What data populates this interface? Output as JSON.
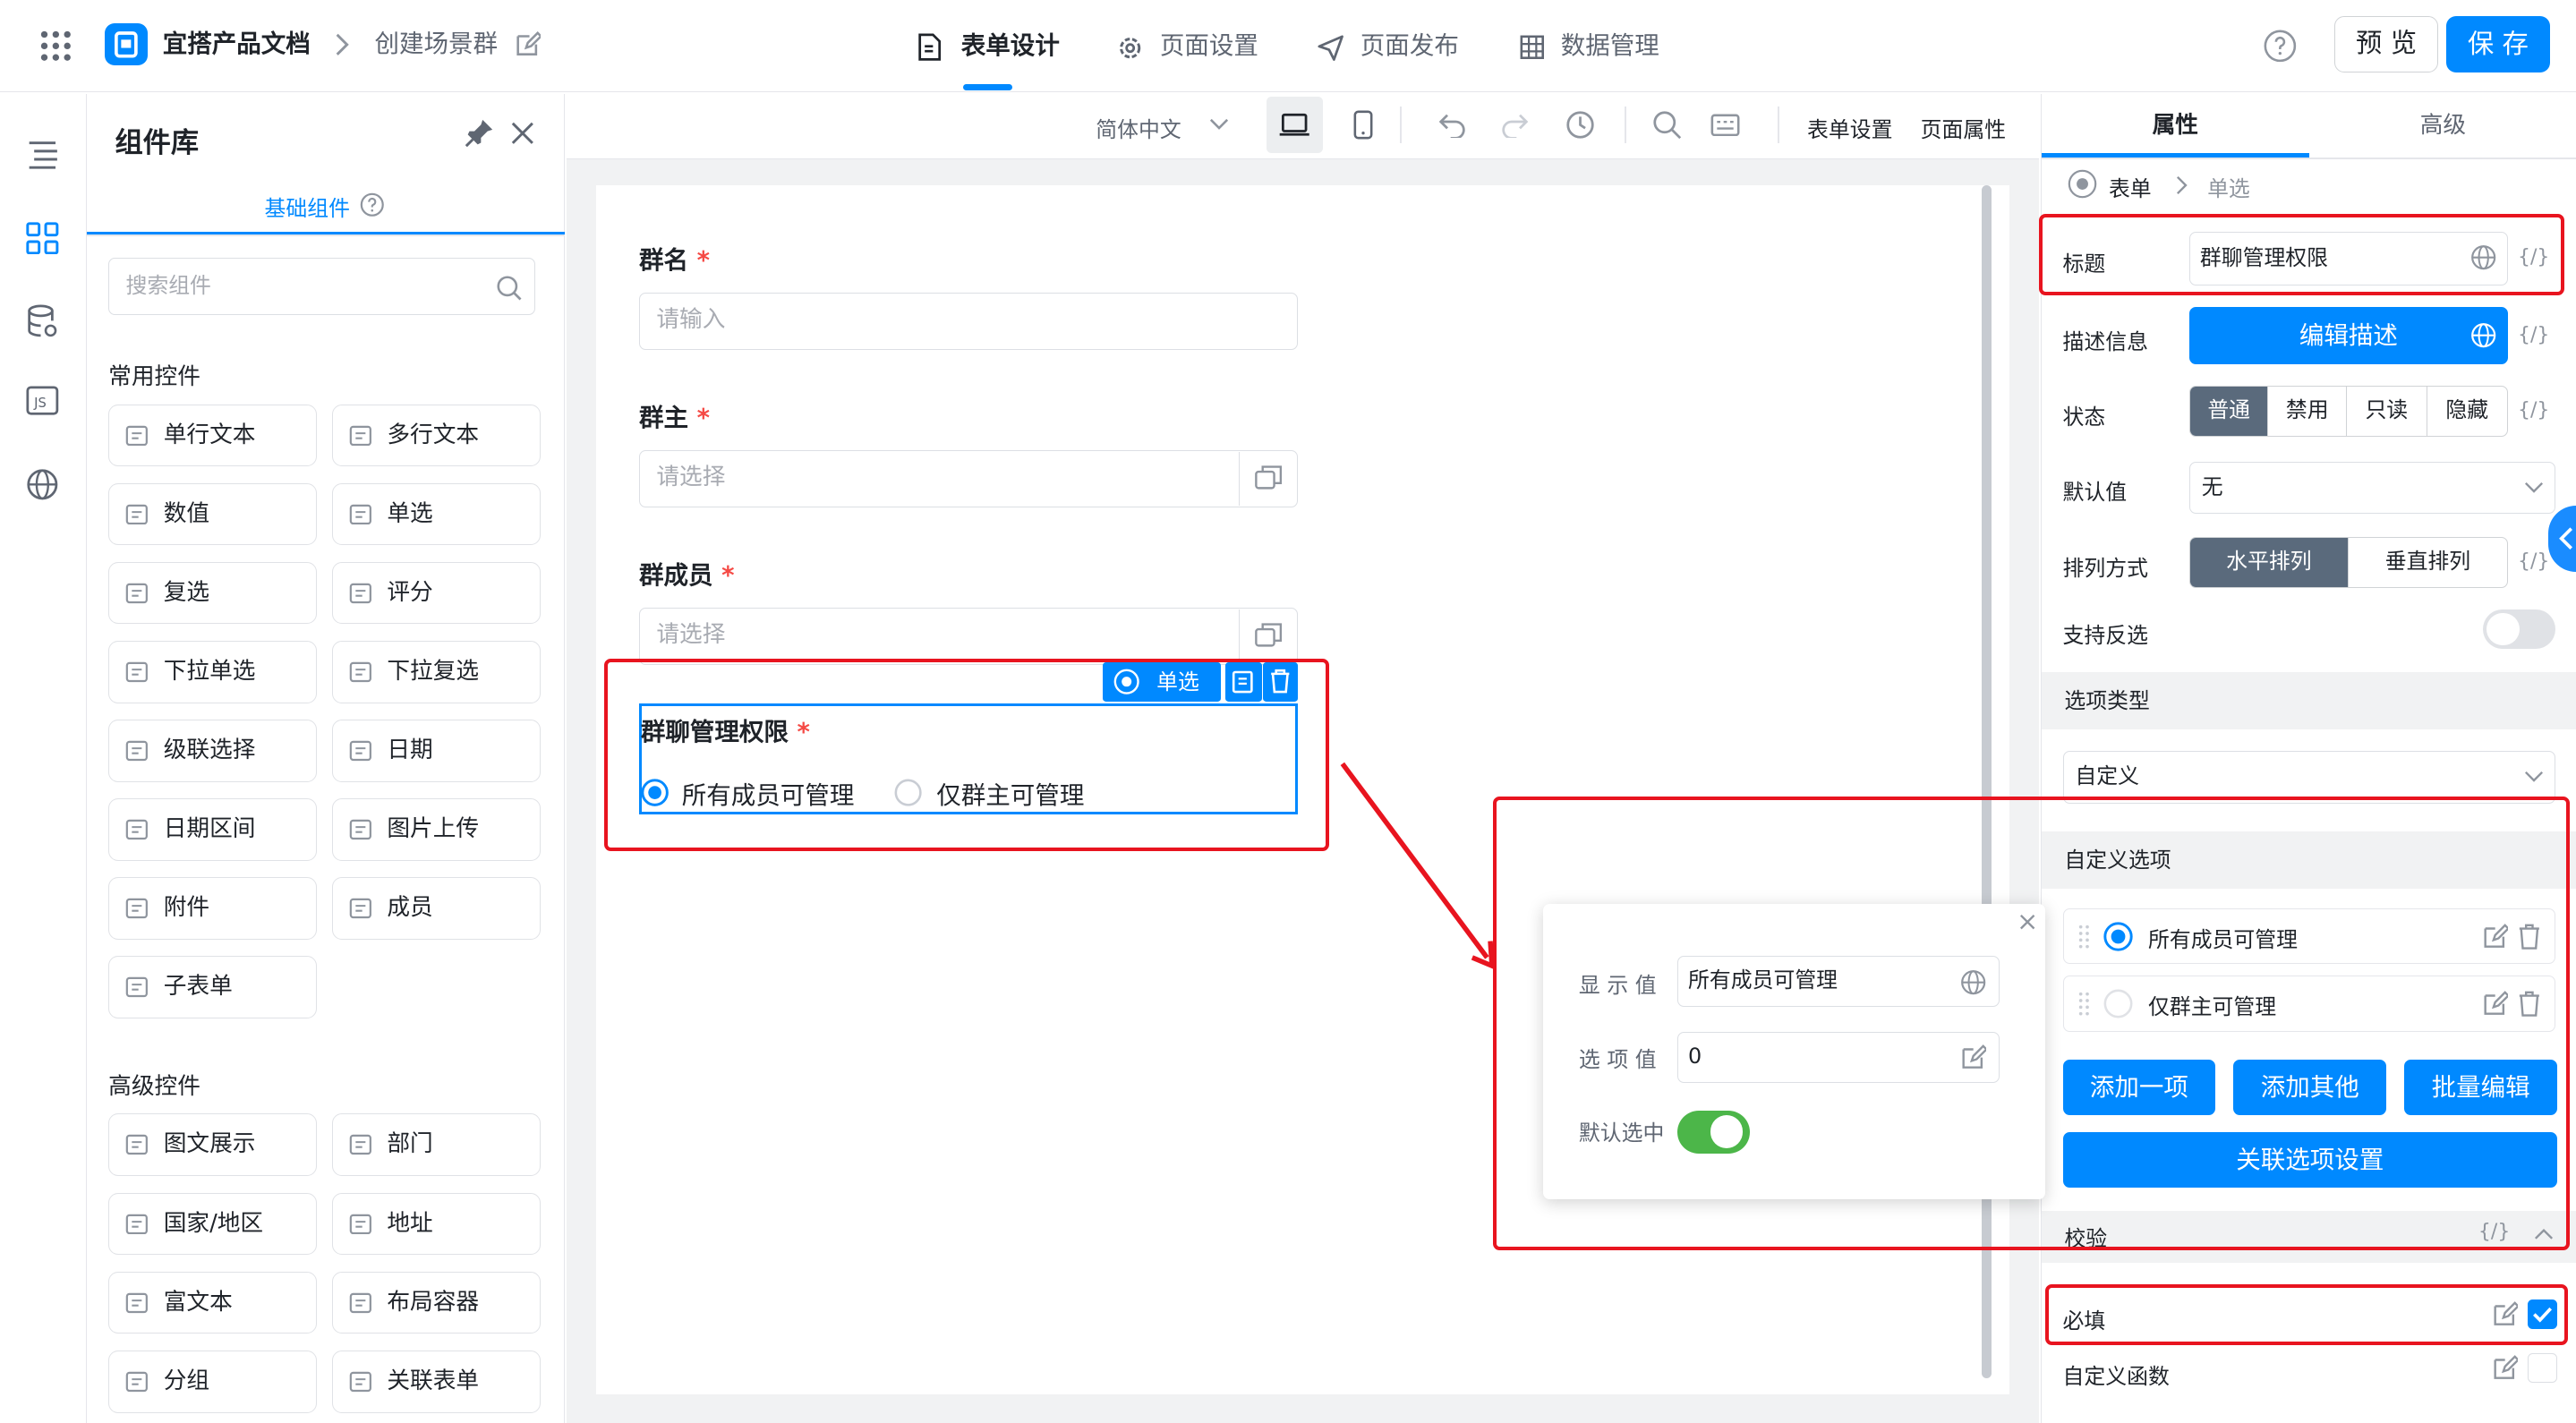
{
  "header": {
    "app_name": "宜搭产品文档",
    "page_name": "创建场景群",
    "tabs": [
      {
        "label": "表单设计",
        "icon": "document-icon"
      },
      {
        "label": "页面设置",
        "icon": "gear-icon"
      },
      {
        "label": "页面发布",
        "icon": "send-icon"
      },
      {
        "label": "数据管理",
        "icon": "table-icon"
      }
    ],
    "preview_label": "预 览",
    "save_label": "保 存"
  },
  "library": {
    "title": "组件库",
    "tab_label": "基础组件",
    "search_placeholder": "搜索组件",
    "common_section": "常用控件",
    "common_items": [
      "单行文本",
      "多行文本",
      "数值",
      "单选",
      "复选",
      "评分",
      "下拉单选",
      "下拉复选",
      "级联选择",
      "日期",
      "日期区间",
      "图片上传",
      "附件",
      "成员",
      "子表单"
    ],
    "advanced_section": "高级控件",
    "advanced_items": [
      "图文展示",
      "部门",
      "国家/地区",
      "地址",
      "富文本",
      "布局容器",
      "分组",
      "关联表单"
    ]
  },
  "toolbar": {
    "language": "简体中文",
    "form_settings": "表单设置",
    "page_props": "页面属性"
  },
  "form": {
    "fields": [
      {
        "label": "群名",
        "placeholder": "请输入"
      },
      {
        "label": "群主",
        "placeholder": "请选择"
      },
      {
        "label": "群成员",
        "placeholder": "请选择"
      }
    ],
    "selected_field": {
      "tag": "单选",
      "label": "群聊管理权限",
      "options": [
        "所有成员可管理",
        "仅群主可管理"
      ],
      "selected_index": 0
    },
    "required_mark": "*"
  },
  "popup": {
    "display_label": "显 示 值",
    "display_value": "所有成员可管理",
    "option_label": "选 项 值",
    "option_value": "0",
    "default_label": "默认选中",
    "default_on": true
  },
  "panel": {
    "tabs": [
      "属性",
      "高级"
    ],
    "breadcrumb": [
      "表单",
      "单选"
    ],
    "title_label": "标题",
    "title_value": "群聊管理权限",
    "desc_label": "描述信息",
    "desc_button": "编辑描述",
    "state_label": "状态",
    "state_options": [
      "普通",
      "禁用",
      "只读",
      "隐藏"
    ],
    "default_label": "默认值",
    "default_value": "无",
    "layout_label": "排列方式",
    "layout_options": [
      "水平排列",
      "垂直排列"
    ],
    "invert_label": "支持反选",
    "option_type_section": "选项类型",
    "option_type_value": "自定义",
    "custom_options_section": "自定义选项",
    "custom_options": [
      "所有成员可管理",
      "仅群主可管理"
    ],
    "add_one": "添加一项",
    "add_other": "添加其他",
    "batch_edit": "批量编辑",
    "linked_settings": "关联选项设置",
    "validation_section": "校验",
    "required_label": "必填",
    "custom_func_label": "自定义函数",
    "fx": "{/}"
  },
  "colors": {
    "accent": "#0089ff",
    "highlight": "#e8141f",
    "toggle_on": "#4cb649"
  }
}
